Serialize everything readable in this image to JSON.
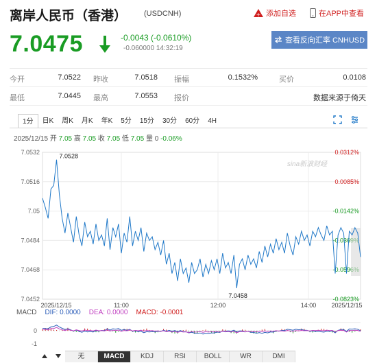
{
  "header": {
    "title": "离岸人民币（香港）",
    "symbol": "(USDCNH)",
    "add_watch": "添加自选",
    "view_in_app": "在APP中查看"
  },
  "quote": {
    "price": "7.0475",
    "change": "-0.0043 (-0.0610%)",
    "sub_line": "-0.060000 14:32:19",
    "reverse_button": "查看反向汇率 CNHUSD"
  },
  "stats": {
    "row1": [
      {
        "label": "今开",
        "value": "7.0522"
      },
      {
        "label": "昨收",
        "value": "7.0518"
      },
      {
        "label": "振幅",
        "value": "0.1532%"
      },
      {
        "label": "买价",
        "value": "0.0108"
      }
    ],
    "row2": [
      {
        "label": "最低",
        "value": "7.0445"
      },
      {
        "label": "最高",
        "value": "7.0553"
      },
      {
        "label": "报价",
        "value": ""
      },
      {
        "label": "",
        "value": "数据来源于倚天"
      }
    ]
  },
  "tabs": [
    "1分",
    "日K",
    "周K",
    "月K",
    "年K",
    "5分",
    "15分",
    "30分",
    "60分",
    "4H"
  ],
  "quote_line": {
    "prefix": "2025/12/15 开 ",
    "open": "7.05",
    "h_label": " 高 ",
    "high": "7.05",
    "c_label": " 收 ",
    "close": "7.05",
    "l_label": " 低 ",
    "low": "7.05",
    "v_label": " 量 0 ",
    "pct": "-0.06%"
  },
  "chart_data": {
    "type": "line",
    "y_ticks": [
      "7.0532",
      "7.0516",
      "7.05",
      "7.0484",
      "7.0468",
      "7.0452"
    ],
    "pct_ticks": [
      "0.0312%",
      "0.0085%",
      "-0.0142%",
      "-0.0369%",
      "-0.0596%",
      "-0.0823%"
    ],
    "x_ticks": [
      "2025/12/15",
      "11:00",
      "12:00",
      "14:00",
      "2025/12/15"
    ],
    "annotations": {
      "max": "7.0528",
      "min": "7.0458"
    },
    "watermark": "sina新浪财经",
    "ylim": [
      7.0452,
      7.0532
    ],
    "line_color": "#1f78c8",
    "values": [
      7.0507,
      7.0502,
      7.0496,
      7.0512,
      7.0514,
      7.0528,
      7.0509,
      7.0496,
      7.0488,
      7.0499,
      7.0491,
      7.0483,
      7.0497,
      7.0487,
      7.0481,
      7.0494,
      7.0486,
      7.0489,
      7.0482,
      7.0493,
      7.0484,
      7.0487,
      7.0481,
      7.0496,
      7.0479,
      7.0491,
      7.0486,
      7.0493,
      7.0477,
      7.0488,
      7.0483,
      7.0497,
      7.0481,
      7.0489,
      7.0484,
      7.0491,
      7.0478,
      7.0488,
      7.0484,
      7.0486,
      7.0479,
      7.0483,
      7.0476,
      7.0484,
      7.0471,
      7.0477,
      7.0466,
      7.0472,
      7.0462,
      7.0474,
      7.0466,
      7.0469,
      7.0461,
      7.0472,
      7.0466,
      7.0468,
      7.0474,
      7.0464,
      7.0471,
      7.0466,
      7.0473,
      7.0468,
      7.0474,
      7.0466,
      7.0477,
      7.0469,
      7.0472,
      7.0466,
      7.0476,
      7.0458,
      7.0471,
      7.0474,
      7.0468,
      7.0476,
      7.0471,
      7.0474,
      7.0469,
      7.0478,
      7.0472,
      7.0481,
      7.0475,
      7.0482,
      7.0477,
      7.0485,
      7.0479,
      7.0483,
      7.0477,
      7.0488,
      7.0481,
      7.0476,
      7.0486,
      7.0482,
      7.0489,
      7.0484,
      7.0487,
      7.0481,
      7.0489,
      7.0486,
      7.0491,
      7.0487,
      7.0484,
      7.0492,
      7.0487,
      7.0489,
      7.0466,
      7.0487,
      7.0491,
      7.0488,
      7.0466,
      7.0489,
      7.0487,
      7.0491,
      7.0488,
      7.0475
    ]
  },
  "macd": {
    "label": "MACD",
    "dif": "DIF: 0.0000",
    "dea": "DEA: 0.0000",
    "macd": "MACD: -0.0001",
    "ticks": [
      "0",
      "-1"
    ]
  },
  "bottom_tabs": [
    "无",
    "MACD",
    "KDJ",
    "RSI",
    "BOLL",
    "WR",
    "DMI"
  ],
  "colors": {
    "up": "#1a9c24",
    "down": "#d01f1f",
    "line": "#1f78c8"
  }
}
